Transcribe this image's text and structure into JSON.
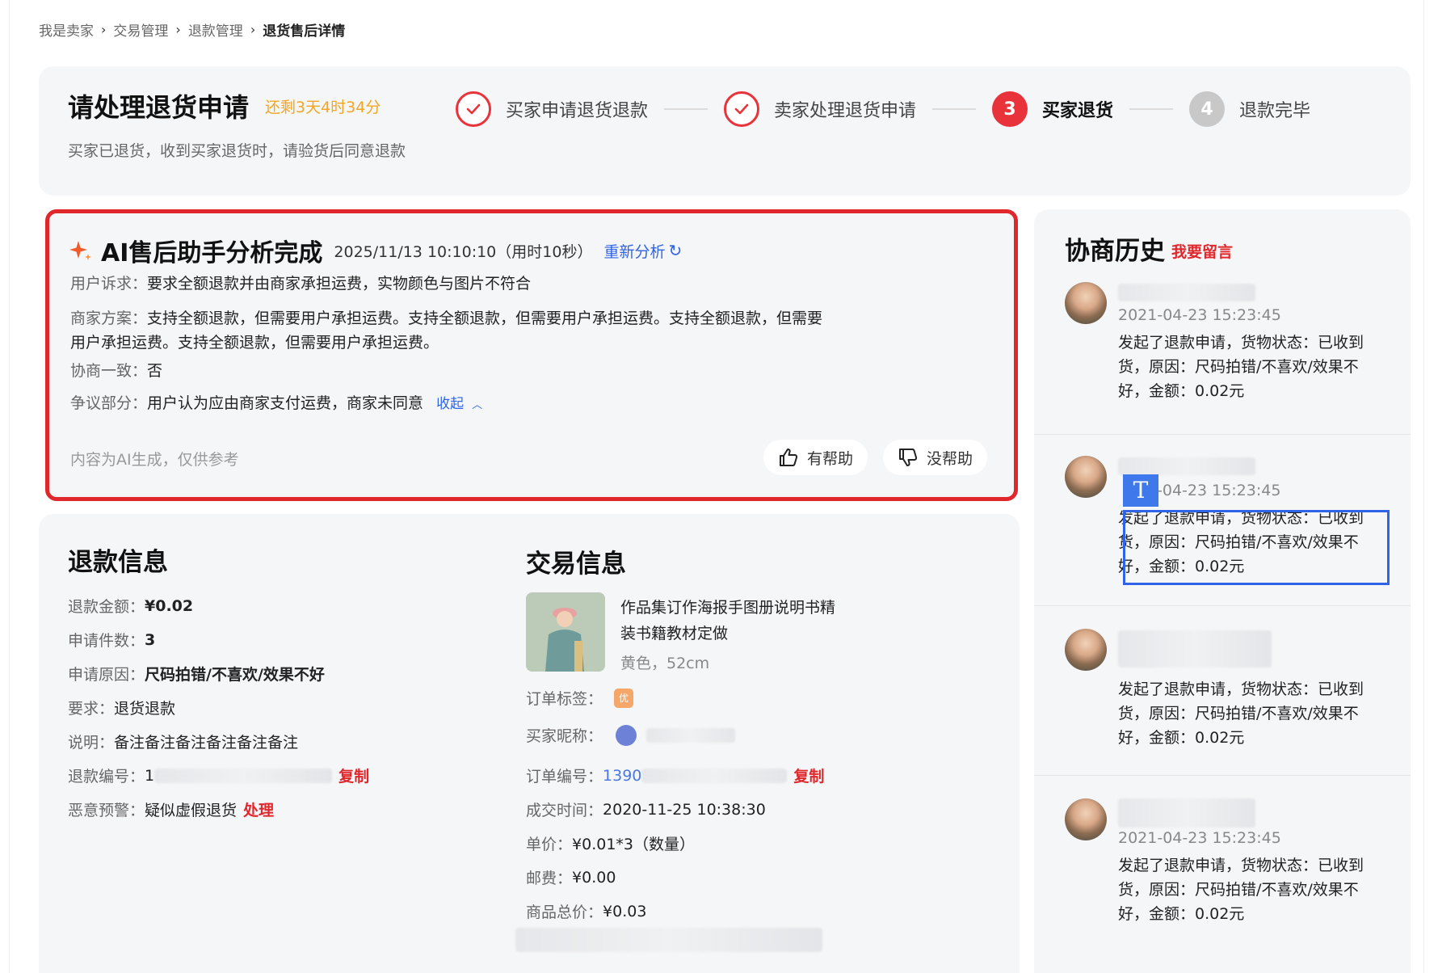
{
  "breadcrumb": {
    "items": [
      "我是卖家",
      "交易管理",
      "退款管理"
    ],
    "current": "退货售后详情"
  },
  "header": {
    "title": "请处理退货申请",
    "countdown": "还剩3天4时34分",
    "description": "买家已退货，收到买家退货时，请验货后同意退款",
    "steps": [
      {
        "label": "买家申请退货退款",
        "state": "done",
        "num": "✓"
      },
      {
        "label": "卖家处理退货申请",
        "state": "done",
        "num": "✓"
      },
      {
        "label": "买家退货",
        "state": "active",
        "num": "3"
      },
      {
        "label": "退款完毕",
        "state": "todo",
        "num": "4"
      }
    ]
  },
  "ai": {
    "title": "AI售后助手分析完成",
    "time": "2025/11/13 10:10:10（用时10秒）",
    "reanalyze": "重新分析",
    "rows": {
      "appeal_k": "用户诉求：",
      "appeal_v": "要求全额退款并由商家承担运费，实物颜色与图片不符合",
      "plan_k": "商家方案：",
      "plan_v1": "支持全额退款，但需要用户承担运费。支持全额退款，但需要用户承担运费。支持全额退款，但需要",
      "plan_v2": "用户承担运费。支持全额退款，但需要用户承担运费。",
      "agree_k": "协商一致：",
      "agree_v": "否",
      "dispute_k": "争议部分：",
      "dispute_v": "用户认为应由商家支付运费，商家未同意",
      "collapse": "收起"
    },
    "note": "内容为AI生成，仅供参考",
    "helpful": "有帮助",
    "unhelpful": "没帮助",
    "accent": "#e0272c"
  },
  "refund": {
    "title": "退款信息",
    "amount_k": "退款金额：",
    "amount_v": "¥0.02",
    "count_k": "申请件数：",
    "count_v": "3",
    "reason_k": "申请原因：",
    "reason_v": "尺码拍错/不喜欢/效果不好",
    "require_k": "要求：",
    "require_v": "退货退款",
    "explain_k": "说明：",
    "explain_v": "备注备注备注备注备注备注",
    "no_k": "退款编号：",
    "no_v": "1",
    "copy": "复制",
    "warn_k": "恶意预警：",
    "warn_v": "疑似虚假退货",
    "handle": "处理"
  },
  "trade": {
    "title": "交易信息",
    "product_title": "作品集订作海报手图册说明书精装书籍教材定做",
    "product_spec": "黄色，52cm",
    "tag_k": "订单标签：",
    "tag_icon": "tag-icon",
    "buyer_k": "买家昵称：",
    "order_k": "订单编号：",
    "order_v": "1390",
    "copy": "复制",
    "time_k": "成交时间：",
    "time_v": "2020-11-25 10:38:30",
    "price_k": "单价：",
    "price_v": "¥0.01*3（数量）",
    "post_k": "邮费：",
    "post_v": "¥0.00",
    "total_k": "商品总价：",
    "total_v": "¥0.03"
  },
  "history": {
    "title": "协商历史",
    "leave_msg": "我要留言",
    "items": [
      {
        "time": "2021-04-23 15:23:45",
        "text": "发起了退款申请，货物状态：已收到货，原因：尺码拍错/不喜欢/效果不好，金额：0.02元"
      },
      {
        "time": "-04-23 15:23:45",
        "text": "发起了退款申请，货物状态：已收到货，原因：尺码拍错/不喜欢/效果不好，金额：0.02元"
      },
      {
        "time": "",
        "text": "发起了退款申请，货物状态：已收到货，原因：尺码拍错/不喜欢/效果不好，金额：0.02元"
      },
      {
        "time": "2021-04-23 15:23:45",
        "text": "发起了退款申请，货物状态：已收到货，原因：尺码拍错/不喜欢/效果不好，金额：0.02元"
      }
    ],
    "text_tool": "T"
  }
}
